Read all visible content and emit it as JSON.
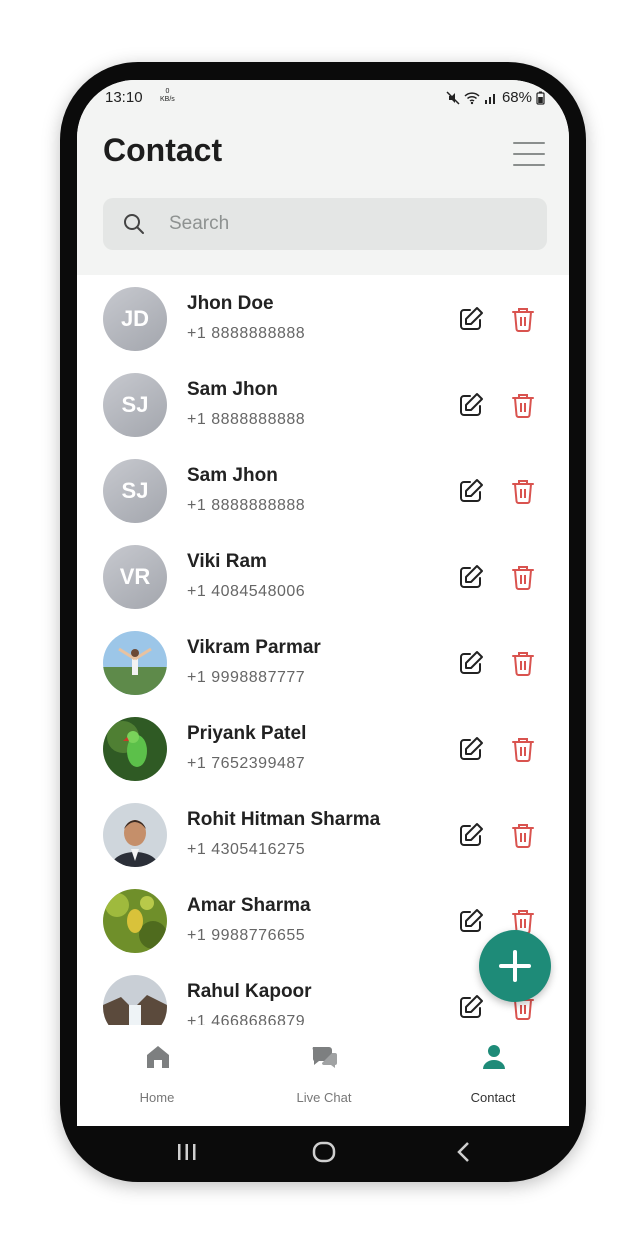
{
  "status_bar": {
    "time": "13:10",
    "speed": "0",
    "speed_unit": "KB/s",
    "battery": "68%"
  },
  "header": {
    "title": "Contact",
    "menu_icon": "hamburger-menu-icon"
  },
  "search": {
    "placeholder": "Search"
  },
  "contacts": [
    {
      "name": "Jhon Doe",
      "phone": "+1 8888888888",
      "initials": "JD"
    },
    {
      "name": "Sam Jhon",
      "phone": "+1 8888888888",
      "initials": "SJ"
    },
    {
      "name": "Sam Jhon",
      "phone": "+1 8888888888",
      "initials": "SJ"
    },
    {
      "name": "Viki Ram",
      "phone": "+1 4084548006",
      "initials": "VR"
    },
    {
      "name": "Vikram Parmar",
      "phone": "+1 9998887777",
      "initials": ""
    },
    {
      "name": "Priyank Patel",
      "phone": "+1 7652399487",
      "initials": ""
    },
    {
      "name": "Rohit Hitman Sharma",
      "phone": "+1 4305416275",
      "initials": ""
    },
    {
      "name": "Amar Sharma",
      "phone": "+1 9988776655",
      "initials": ""
    },
    {
      "name": "Rahul Kapoor",
      "phone": "+1 4668686879",
      "initials": ""
    }
  ],
  "bottom_nav": [
    {
      "label": "Home",
      "icon": "home-icon"
    },
    {
      "label": "Live Chat",
      "icon": "chat-icon"
    },
    {
      "label": "Contact",
      "icon": "person-icon"
    }
  ],
  "colors": {
    "accent": "#1e8b78",
    "delete": "#d9534f",
    "background": "#f3f4f3"
  }
}
